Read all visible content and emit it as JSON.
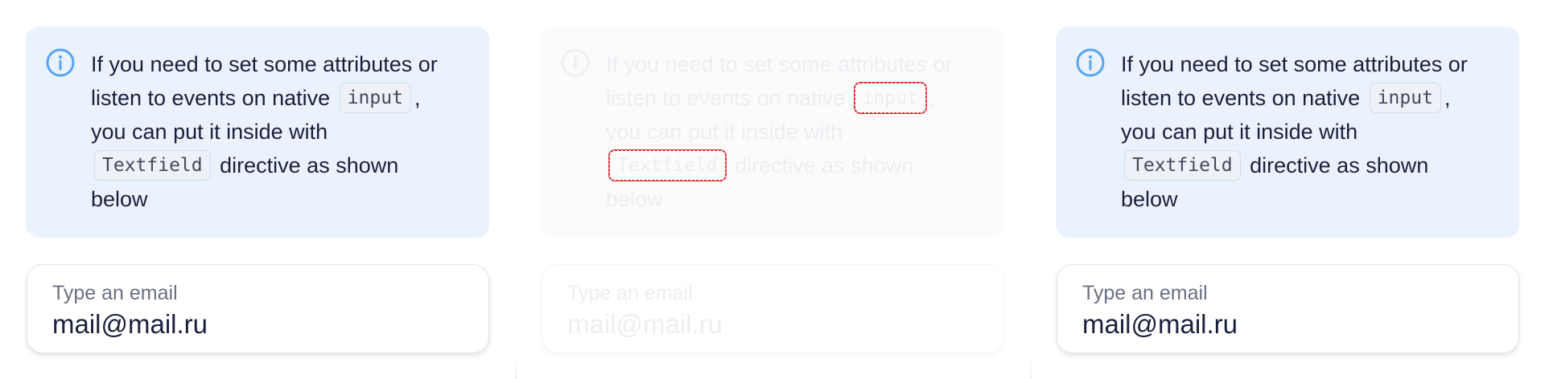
{
  "panels": [
    {
      "state": "normal",
      "notice": {
        "icon": "info-icon",
        "line1": "If you need to set some attributes or",
        "line2_before": "listen to events on native",
        "code1": "input",
        "line2_after": ",",
        "line3": "you can put it inside with",
        "code2": "Textfield",
        "line4_after": "directive as shown",
        "line5": "below"
      },
      "field": {
        "label": "Type an email",
        "value": "mail@mail.ru"
      }
    },
    {
      "state": "faded-highlight",
      "notice": {
        "icon": "info-icon",
        "line1": "If you need to set some attributes or",
        "line2_before": "listen to events on native",
        "code1": "input",
        "line2_after": ",",
        "line3": "you can put it inside with",
        "code2": "Textfield",
        "line4_after": "directive as shown",
        "line5": "below"
      },
      "field": {
        "label": "Type an email",
        "value": "mail@mail.ru"
      }
    },
    {
      "state": "normal",
      "notice": {
        "icon": "info-icon",
        "line1": "If you need to set some attributes or",
        "line2_before": "listen to events on native",
        "code1": "input",
        "line2_after": ",",
        "line3": "you can put it inside with",
        "code2": "Textfield",
        "line4_after": "directive as shown",
        "line5": "below"
      },
      "field": {
        "label": "Type an email",
        "value": "mail@mail.ru"
      }
    }
  ],
  "colors": {
    "notice_bg": "#eaf3fd",
    "info_icon": "#5aa3f0",
    "text": "#1b1f3b",
    "label": "#6b6f82",
    "highlight_outline": "#d21a1a"
  }
}
